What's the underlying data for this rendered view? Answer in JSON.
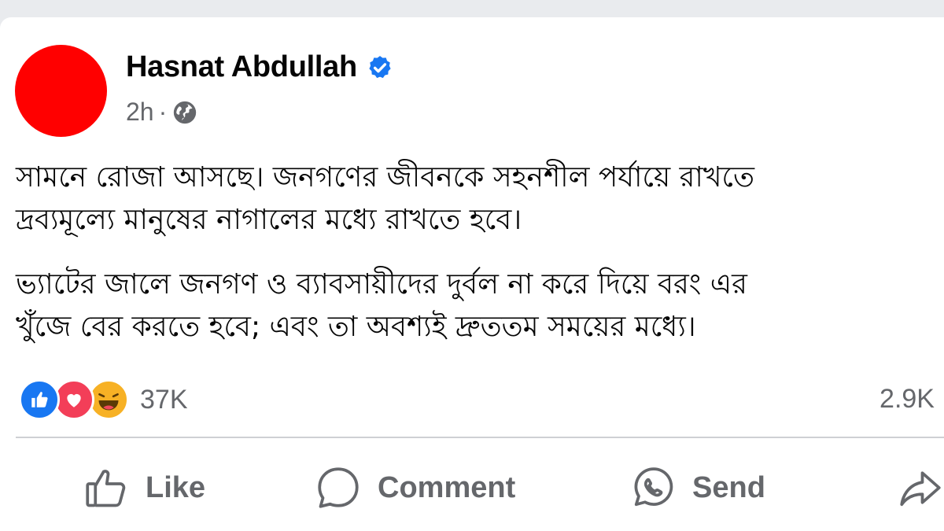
{
  "post": {
    "author": "Hasnat Abdullah",
    "time": "2h",
    "separator": "·",
    "avatar_color": "#ff0000",
    "verified_icon": "verified-badge-icon",
    "privacy_icon": "globe-icon",
    "paragraphs": [
      {
        "line1": "সামনে রোজা আসছে। জনগণের জীবনকে সহনশীল পর্যায়ে রাখতে",
        "line2": "দ্রব্যমূল্যে মানুষের নাগালের মধ্যে রাখতে হবে।"
      },
      {
        "line1": "ভ্যাটের জালে জনগণ ও ব্যাবসায়ীদের দুর্বল না করে দিয়ে বরং এর",
        "line2": "খুঁজে বের করতে হবে; এবং তা অবশ্যই দ্রুততম সময়ের মধ্যে।"
      }
    ]
  },
  "engagement": {
    "reaction_icons": [
      "like-reaction-icon",
      "love-reaction-icon",
      "haha-reaction-icon"
    ],
    "reaction_count": "37K",
    "comment_count": "2.9K"
  },
  "actions": {
    "like_label": "Like",
    "comment_label": "Comment",
    "send_label": "Send"
  },
  "colors": {
    "accent": "#1877f2",
    "love": "#f33e58",
    "haha": "#f7b125",
    "secondary_text": "#65676b",
    "divider": "#ced0d4",
    "background": "#e9ebee"
  }
}
